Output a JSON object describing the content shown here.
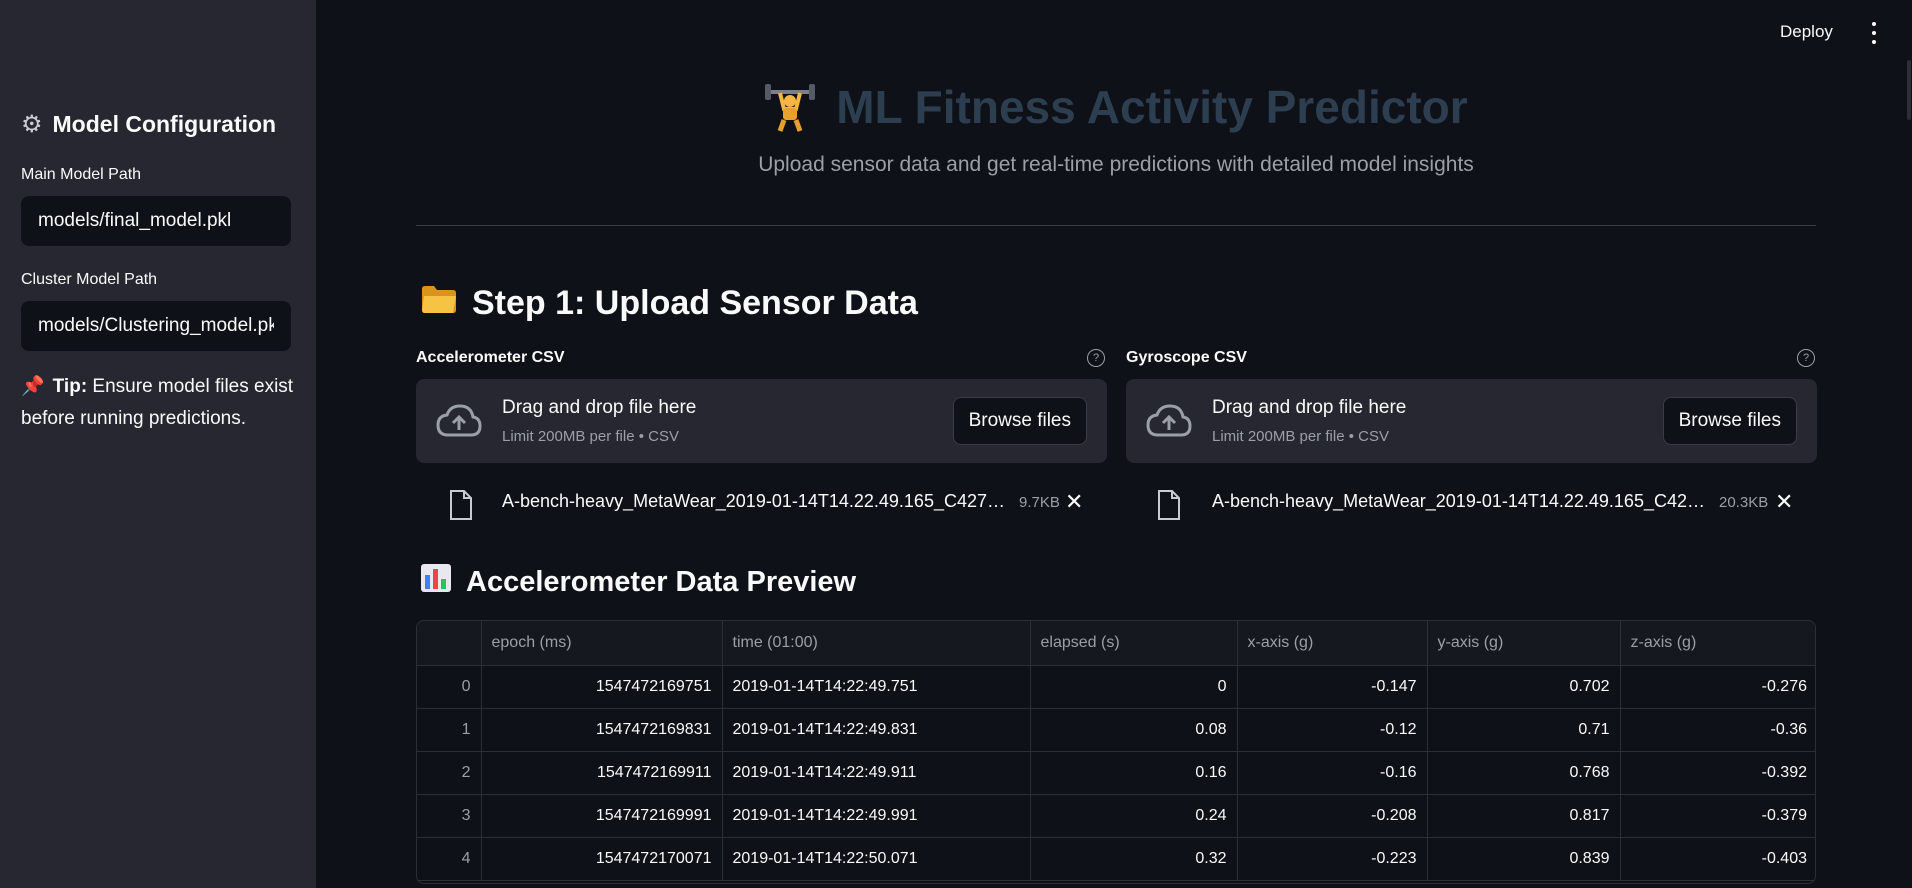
{
  "header": {
    "deploy_label": "Deploy",
    "menu_icon": "kebab-menu-icon"
  },
  "sidebar": {
    "title": "Model Configuration",
    "title_icon": "gear-icon",
    "main_model": {
      "label": "Main Model Path",
      "value": "models/final_model.pkl"
    },
    "cluster_model": {
      "label": "Cluster Model Path",
      "value": "models/Clustering_model.pk"
    },
    "tip": {
      "icon": "pushpin-icon",
      "bold": "Tip:",
      "text": " Ensure model files exist before running predictions."
    }
  },
  "hero": {
    "icon": "weightlifter-icon",
    "title": "ML Fitness Activity Predictor",
    "subtitle": "Upload sensor data and get real-time predictions with detailed model insights"
  },
  "step1": {
    "icon": "folder-icon",
    "title": "Step 1: Upload Sensor Data"
  },
  "uploaders": [
    {
      "label": "Accelerometer CSV",
      "drop_text": "Drag and drop file here",
      "limit_text": "Limit 200MB per file • CSV",
      "browse_label": "Browse files",
      "file_name": "A-bench-heavy_MetaWear_2019-01-14T14.22.49.165_C427…",
      "file_size": "9.7KB"
    },
    {
      "label": "Gyroscope CSV",
      "drop_text": "Drag and drop file here",
      "limit_text": "Limit 200MB per file • CSV",
      "browse_label": "Browse files",
      "file_name": "A-bench-heavy_MetaWear_2019-01-14T14.22.49.165_C42…",
      "file_size": "20.3KB"
    }
  ],
  "preview": {
    "icon": "bar-chart-icon",
    "title": "Accelerometer Data Preview",
    "columns": [
      "",
      "epoch (ms)",
      "time (01:00)",
      "elapsed (s)",
      "x-axis (g)",
      "y-axis (g)",
      "z-axis (g)"
    ],
    "rows": [
      [
        "0",
        "1547472169751",
        "2019-01-14T14:22:49.751",
        "0",
        "-0.147",
        "0.702",
        "-0.276"
      ],
      [
        "1",
        "1547472169831",
        "2019-01-14T14:22:49.831",
        "0.08",
        "-0.12",
        "0.71",
        "-0.36"
      ],
      [
        "2",
        "1547472169911",
        "2019-01-14T14:22:49.911",
        "0.16",
        "-0.16",
        "0.768",
        "-0.392"
      ],
      [
        "3",
        "1547472169991",
        "2019-01-14T14:22:49.991",
        "0.24",
        "-0.208",
        "0.817",
        "-0.379"
      ],
      [
        "4",
        "1547472170071",
        "2019-01-14T14:22:50.071",
        "0.32",
        "-0.223",
        "0.839",
        "-0.403"
      ]
    ]
  }
}
